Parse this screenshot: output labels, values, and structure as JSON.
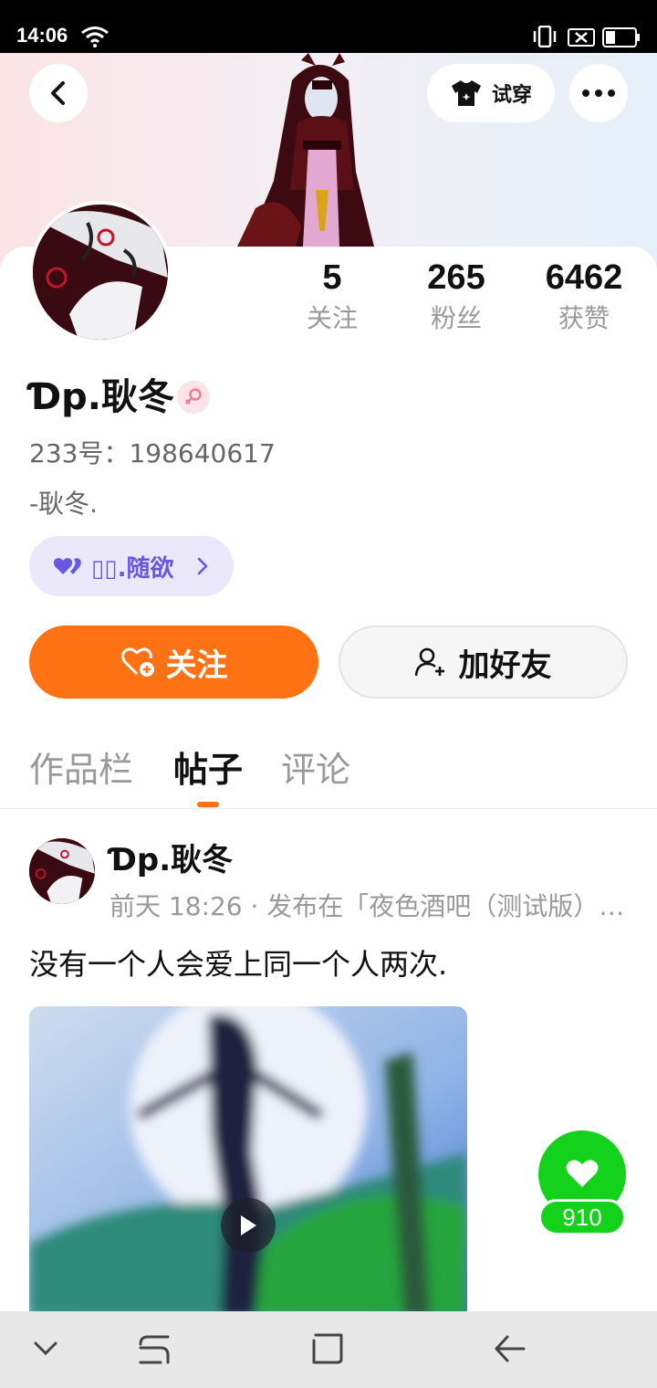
{
  "status_bar": {
    "time": "14:06"
  },
  "header": {
    "tryon_label": "试穿"
  },
  "stats": [
    {
      "value": "5",
      "label": "关注"
    },
    {
      "value": "265",
      "label": "粉丝"
    },
    {
      "value": "6462",
      "label": "获赞"
    }
  ],
  "profile": {
    "username": "Ɗp.耿冬",
    "gender_icon": "female-icon",
    "user_id": "233号：198640617",
    "bio": "-耿冬.",
    "relation": "▯▯.随欲"
  },
  "actions": {
    "follow_label": "关注",
    "add_friend_label": "加好友"
  },
  "tabs": [
    {
      "label": "作品栏",
      "active": false
    },
    {
      "label": "帖子",
      "active": true
    },
    {
      "label": "评论",
      "active": false
    }
  ],
  "post": {
    "author": "Ɗp.耿冬",
    "meta": "前天 18:26 · 发布在「夜色酒吧（测试版）…",
    "text": "没有一个人会爱上同一个人两次.",
    "like_count": "910"
  },
  "colors": {
    "accent": "#ff7213",
    "like_green": "#14d21c",
    "relation_purple": "#6a58e0"
  }
}
